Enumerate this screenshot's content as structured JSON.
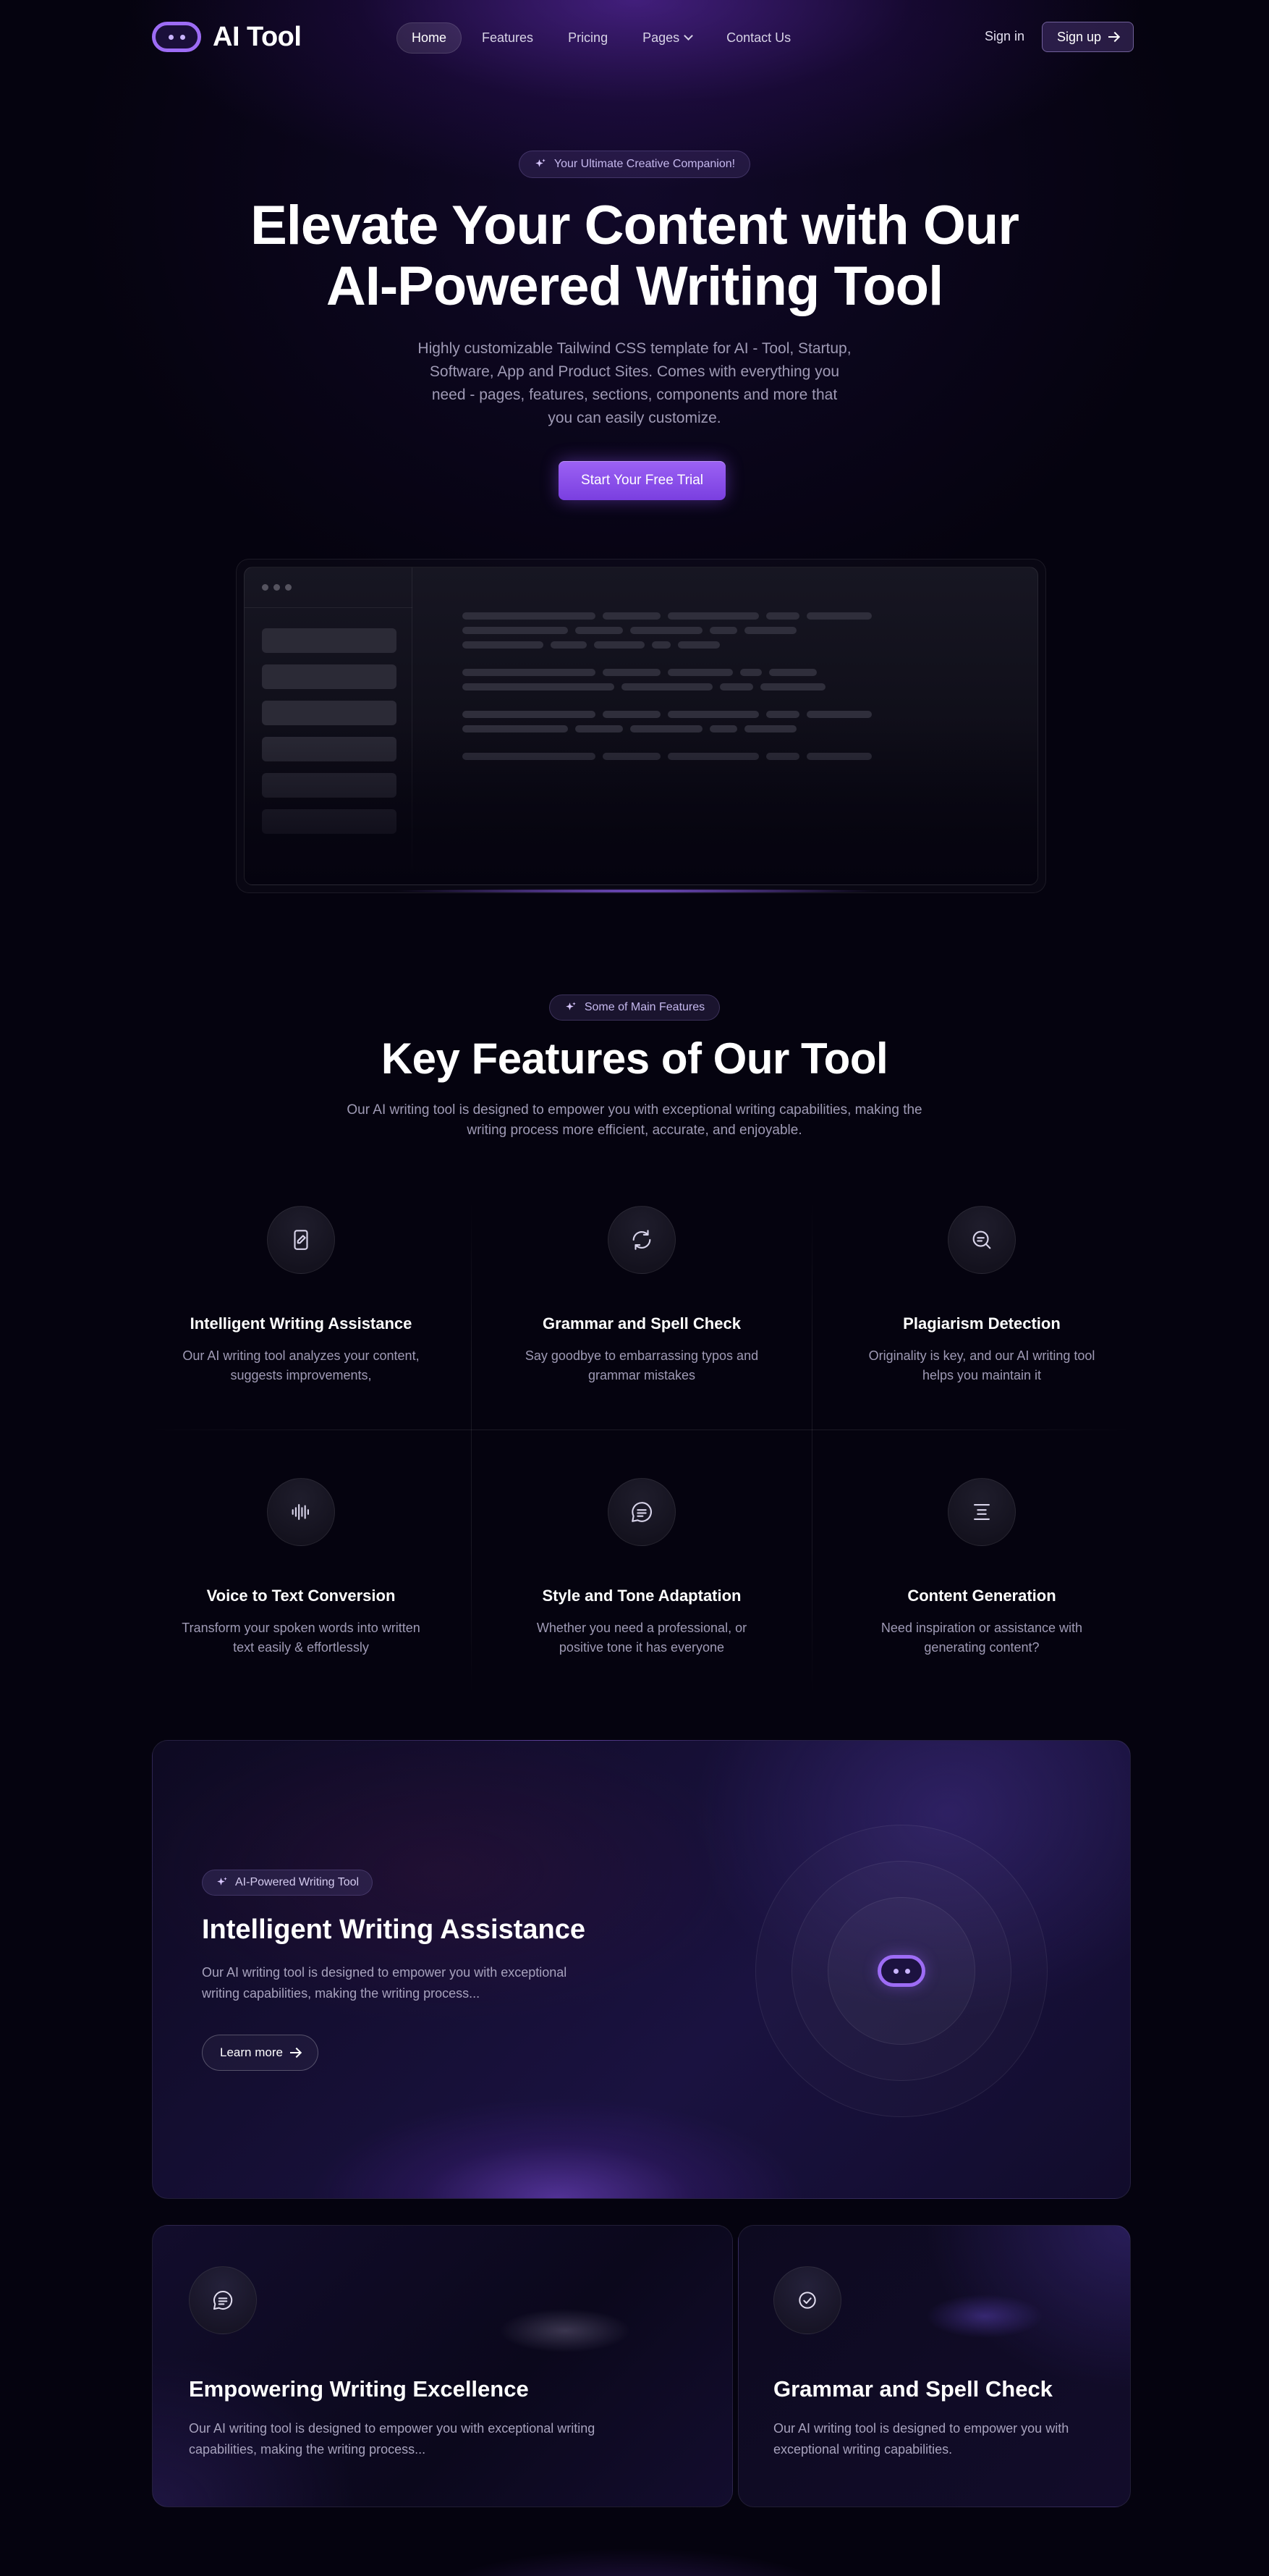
{
  "brand": {
    "name": "AI Tool",
    "accent": "#9d6cf5",
    "background": "#05030f"
  },
  "nav": {
    "items": [
      {
        "label": "Home",
        "active": true
      },
      {
        "label": "Features"
      },
      {
        "label": "Pricing"
      },
      {
        "label": "Pages",
        "dropdown": true
      },
      {
        "label": "Contact Us"
      }
    ],
    "signin": "Sign in",
    "signup": "Sign up"
  },
  "hero": {
    "badge": "Your Ultimate Creative Companion!",
    "title_line1": "Elevate Your Content with Our",
    "title_line2": "AI-Powered Writing Tool",
    "subtitle": "Highly customizable Tailwind CSS template for AI - Tool, Startup, Software, App and Product Sites. Comes with everything you need - pages, features, sections, components and more that you can easily customize.",
    "cta": "Start Your Free Trial"
  },
  "features": {
    "badge": "Some of Main Features",
    "title": "Key Features of Our Tool",
    "subtitle": "Our AI writing tool is designed to empower you with exceptional writing capabilities, making the writing process more efficient, accurate, and enjoyable.",
    "items": [
      {
        "icon": "document-edit-icon",
        "title": "Intelligent Writing Assistance",
        "description": "Our AI writing tool analyzes your content, suggests improvements,"
      },
      {
        "icon": "refresh-icon",
        "title": "Grammar and Spell Check",
        "description": "Say goodbye to embarrassing typos and grammar mistakes"
      },
      {
        "icon": "search-document-icon",
        "title": "Plagiarism Detection",
        "description": "Originality is key, and our AI writing tool helps you maintain it"
      },
      {
        "icon": "audio-wave-icon",
        "title": "Voice to Text Conversion",
        "description": "Transform your spoken words into written text easily & effortlessly"
      },
      {
        "icon": "chat-bubble-icon",
        "title": "Style and Tone Adaptation",
        "description": "Whether you need a professional, or positive tone it has everyone"
      },
      {
        "icon": "text-lines-icon",
        "title": "Content Generation",
        "description": "Need inspiration or assistance with generating content?"
      }
    ]
  },
  "showcase": {
    "badge": "AI-Powered Writing Tool",
    "title": "Intelligent Writing Assistance",
    "description": "Our AI writing tool is designed to empower you with exceptional writing capabilities, making the writing process...",
    "button": "Learn more"
  },
  "cards": [
    {
      "icon": "chat-bubble-icon",
      "title": "Empowering Writing Excellence",
      "description": "Our AI writing tool is designed to empower you with exceptional writing capabilities, making the writing process..."
    },
    {
      "icon": "check-circle-icon",
      "title": "Grammar and Spell Check",
      "description": "Our AI writing tool is designed to empower you with exceptional writing capabilities."
    }
  ]
}
